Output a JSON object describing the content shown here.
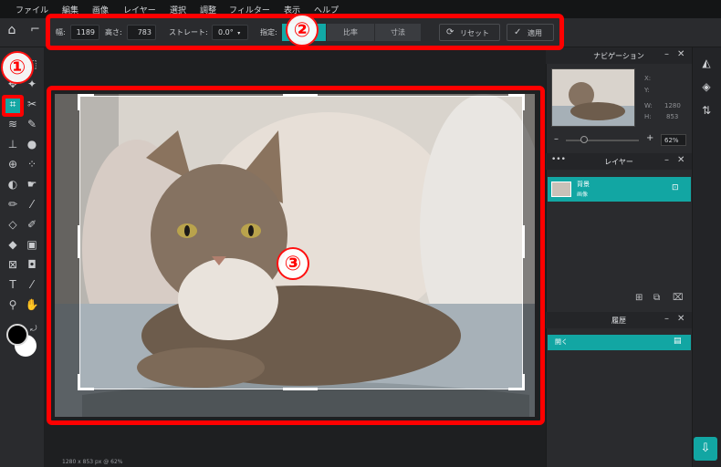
{
  "menu": [
    "ファイル",
    "編集",
    "画像",
    "レイヤー",
    "選択",
    "調整",
    "フィルター",
    "表示",
    "ヘルプ"
  ],
  "toolbar": {
    "width_label": "幅:",
    "width_value": "1189",
    "height_label": "高さ:",
    "height_value": "783",
    "straighten_label": "ストレート:",
    "straighten_value": "0.0°",
    "constraint_label": "指定:",
    "constraint_options": [
      "なし",
      "比率",
      "寸法"
    ],
    "reset_label": "リセット",
    "apply_label": "適用"
  },
  "panels": {
    "navigation_title": "ナビゲーション",
    "nav_x": "X:",
    "nav_y": "Y:",
    "nav_w_label": "W:",
    "nav_w": "1280",
    "nav_h_label": "H:",
    "nav_h": "853",
    "zoom": "62%",
    "layers_title": "レイヤー",
    "layer_name": "背景",
    "layer_type": "画像",
    "history_title": "履歴",
    "history_item": "開く"
  },
  "status": "1280 x 853 px @ 62%",
  "annotations": [
    "①",
    "②",
    "③"
  ],
  "colors": {
    "accent": "#12a6a3",
    "annotation": "#ff0000",
    "foreground_swatch": "#000000",
    "background_swatch": "#ffffff"
  }
}
